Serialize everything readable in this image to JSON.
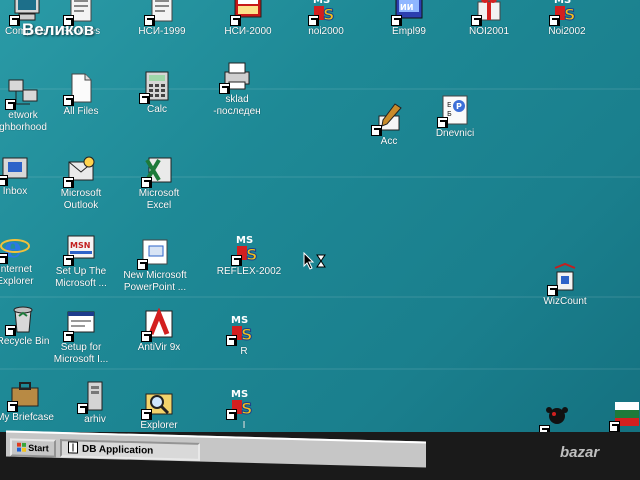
{
  "overlay_title": "Великов",
  "icons": [
    {
      "name": "my-computer-icon",
      "label": "Computer",
      "glyph": "computer"
    },
    {
      "name": "services-icon",
      "label": "Services",
      "glyph": "doc"
    },
    {
      "name": "nsi-1999-icon",
      "label": "НСИ-1999",
      "glyph": "doc"
    },
    {
      "name": "nsi-2000-icon",
      "label": "НСИ-2000",
      "glyph": "nsi"
    },
    {
      "name": "noi2000-icon",
      "label": "noi2000",
      "glyph": "ms"
    },
    {
      "name": "empl99-icon",
      "label": "Empl99",
      "glyph": "empl"
    },
    {
      "name": "noi2001-icon",
      "label": "NOI2001",
      "glyph": "gift"
    },
    {
      "name": "noi2002-icon",
      "label": "Noi2002",
      "glyph": "ms"
    },
    {
      "name": "network-neighborhood-icon",
      "label": "etwork\nghborhood",
      "glyph": "network"
    },
    {
      "name": "all-files-icon",
      "label": "All Files",
      "glyph": "file"
    },
    {
      "name": "calc-icon",
      "label": "Calc",
      "glyph": "calc"
    },
    {
      "name": "sklad-icon",
      "label": "sklad\n-последен",
      "glyph": "printer"
    },
    {
      "name": "acc-icon",
      "label": "Acc",
      "glyph": "acc"
    },
    {
      "name": "dnevnici-icon",
      "label": "Dnevnici",
      "glyph": "dnevnici"
    },
    {
      "name": "inbox-icon",
      "label": "Inbox",
      "glyph": "inbox"
    },
    {
      "name": "microsoft-outlook-icon",
      "label": "Microsoft\nOutlook",
      "glyph": "outlook"
    },
    {
      "name": "microsoft-excel-icon",
      "label": "Microsoft\nExcel",
      "glyph": "excel"
    },
    {
      "name": "internet-explorer-icon",
      "label": "Internet\nExplorer",
      "glyph": "ie"
    },
    {
      "name": "set-up-microsoft-icon",
      "label": "Set Up The\nMicrosoft ...",
      "glyph": "msn"
    },
    {
      "name": "new-powerpoint-icon",
      "label": "New Microsoft\nPowerPoint ...",
      "glyph": "ppt"
    },
    {
      "name": "reflex-2002-icon",
      "label": "REFLEX-2002",
      "glyph": "ms"
    },
    {
      "name": "wizcount-icon",
      "label": "WizCount",
      "glyph": "wiz"
    },
    {
      "name": "recycle-bin-icon",
      "label": "Recycle Bin",
      "glyph": "recycle"
    },
    {
      "name": "setup-microsoft-icon",
      "label": "Setup for\nMicrosoft I...",
      "glyph": "setup"
    },
    {
      "name": "antivir-icon",
      "label": "AntiVir 9x",
      "glyph": "antivir"
    },
    {
      "name": "r-icon",
      "label": "R",
      "glyph": "ms"
    },
    {
      "name": "my-briefcase-icon",
      "label": "My Briefcase",
      "glyph": "briefcase"
    },
    {
      "name": "arhiv-icon",
      "label": "arhiv",
      "glyph": "tower"
    },
    {
      "name": "explorer-icon",
      "label": "Explorer",
      "glyph": "explorer"
    },
    {
      "name": "i-icon",
      "label": "I",
      "glyph": "ms"
    },
    {
      "name": "game-icon",
      "label": "",
      "glyph": "game"
    },
    {
      "name": "flag-icon",
      "label": "",
      "glyph": "flag"
    }
  ],
  "taskbar": {
    "start_label": "Start",
    "task_label": "DB Application"
  },
  "watermark": "bazar"
}
